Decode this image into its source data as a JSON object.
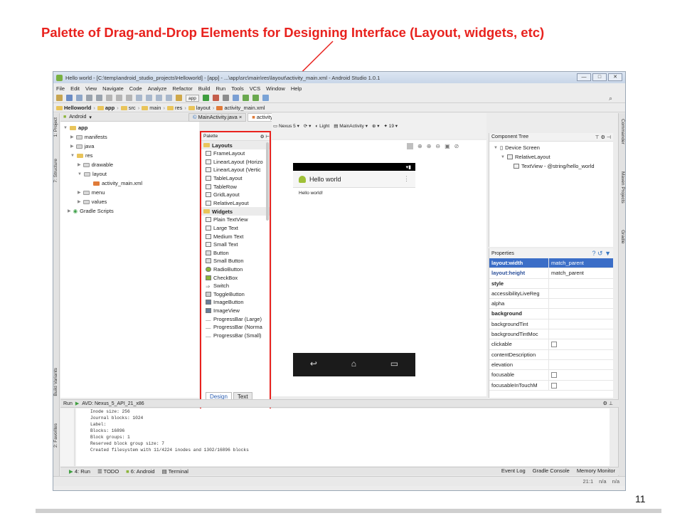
{
  "slide": {
    "title": "Palette of Drag-and-Drop Elements for Designing Interface (Layout, widgets, etc)",
    "page_number": "11"
  },
  "window": {
    "title": "Hello world - [C:\\temp\\android_studio_projects\\Helloworld] - [app] - ...\\app\\src\\main\\res\\layout\\activity_main.xml - Android Studio 1.0.1"
  },
  "menu": [
    "File",
    "Edit",
    "View",
    "Navigate",
    "Code",
    "Analyze",
    "Refactor",
    "Build",
    "Run",
    "Tools",
    "VCS",
    "Window",
    "Help"
  ],
  "toolbar": {
    "app_selector": "app"
  },
  "breadcrumbs": [
    "Helloworld",
    "app",
    "src",
    "main",
    "res",
    "layout",
    "activity_main.xml"
  ],
  "left_tabs": [
    "1: Project",
    "7: Structure",
    "Build Variants",
    "2: Favorites"
  ],
  "right_tabs": [
    "Commander",
    "Maven Projects",
    "Gradle"
  ],
  "project": {
    "view_selector": "Android",
    "tree": [
      "app",
      "manifests",
      "java",
      "res",
      "drawable",
      "layout",
      "activity_main.xml",
      "menu",
      "values",
      "Gradle Scripts"
    ]
  },
  "editor_tabs": [
    "MainActivity.java",
    "activity_main.xml"
  ],
  "design_toolbar": {
    "device": "Nexus 5",
    "theme": "Light",
    "activity": "MainActivity",
    "api": "19"
  },
  "palette": {
    "header": "Palette",
    "layouts_label": "Layouts",
    "layouts": [
      "FrameLayout",
      "LinearLayout (Horizo",
      "LinearLayout (Vertic",
      "TableLayout",
      "TableRow",
      "GridLayout",
      "RelativeLayout"
    ],
    "widgets_label": "Widgets",
    "widgets": [
      "Plain TextView",
      "Large Text",
      "Medium Text",
      "Small Text",
      "Button",
      "Small Button",
      "RadioButton",
      "CheckBox",
      "Switch",
      "ToggleButton",
      "ImageButton",
      "ImageView",
      "ProgressBar (Large)",
      "ProgressBar (Norma",
      "ProgressBar (Small)"
    ]
  },
  "phone": {
    "app_title": "Hello world",
    "content": "Hello world!"
  },
  "design_switch": {
    "design": "Design",
    "text": "Text"
  },
  "component_tree": {
    "header": "Component Tree",
    "rows": [
      "Device Screen",
      "RelativeLayout",
      "TextView - @string/hello_world"
    ]
  },
  "properties": {
    "header": "Properties",
    "rows": [
      {
        "k": "layout:width",
        "v": "match_parent"
      },
      {
        "k": "layout:height",
        "v": "match_parent"
      },
      {
        "k": "style",
        "v": ""
      },
      {
        "k": "accessibilityLiveReg",
        "v": ""
      },
      {
        "k": "alpha",
        "v": ""
      },
      {
        "k": "background",
        "v": ""
      },
      {
        "k": "backgroundTint",
        "v": ""
      },
      {
        "k": "backgroundTintMoc",
        "v": ""
      },
      {
        "k": "clickable",
        "v": ""
      },
      {
        "k": "contentDescription",
        "v": ""
      },
      {
        "k": "elevation",
        "v": ""
      },
      {
        "k": "focusable",
        "v": ""
      },
      {
        "k": "focusableInTouchM",
        "v": ""
      }
    ]
  },
  "run": {
    "header": "Run",
    "target": "AVD: Nexus_5_API_21_x86",
    "console": [
      "Inode size: 256",
      "Journal blocks: 1024",
      "Label:",
      "Blocks: 16896",
      "Block groups: 1",
      "Reserved block group size: 7",
      "Created filesystem with 11/4224 inodes and 1302/16896 blocks"
    ]
  },
  "bottom_tabs": [
    "4: Run",
    "TODO",
    "6: Android",
    "Terminal"
  ],
  "bottom_right": [
    "Event Log",
    "Gradle Console",
    "Memory Monitor"
  ],
  "status": {
    "position": "21:1",
    "a": "n/a",
    "b": "n/a"
  },
  "colors": {
    "accent_red": "#e8221e",
    "selection_blue": "#3b6ec7"
  }
}
